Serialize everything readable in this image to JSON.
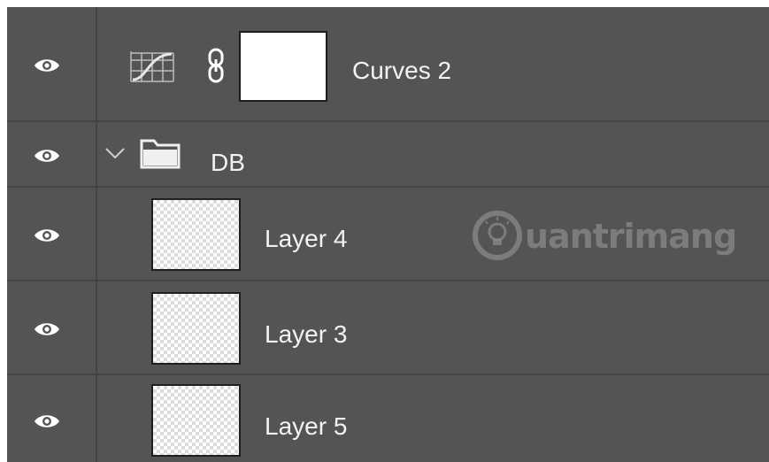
{
  "layers": [
    {
      "type": "adjustment",
      "name": "Curves 2",
      "icon": "curves-adjustment-icon",
      "has_mask": true,
      "visible": true
    },
    {
      "type": "group",
      "name": "DB",
      "icon": "folder-icon",
      "expanded": true,
      "visible": true
    },
    {
      "type": "pixel",
      "name": "Layer 4",
      "visible": true
    },
    {
      "type": "pixel",
      "name": "Layer 3",
      "visible": true
    },
    {
      "type": "pixel",
      "name": "Layer 5",
      "visible": true
    }
  ],
  "watermark": {
    "text": "uantrimang",
    "logo": "lightbulb-logo"
  },
  "colors": {
    "panel": "#545454",
    "divider": "#444444",
    "text": "#f2f2f2"
  }
}
